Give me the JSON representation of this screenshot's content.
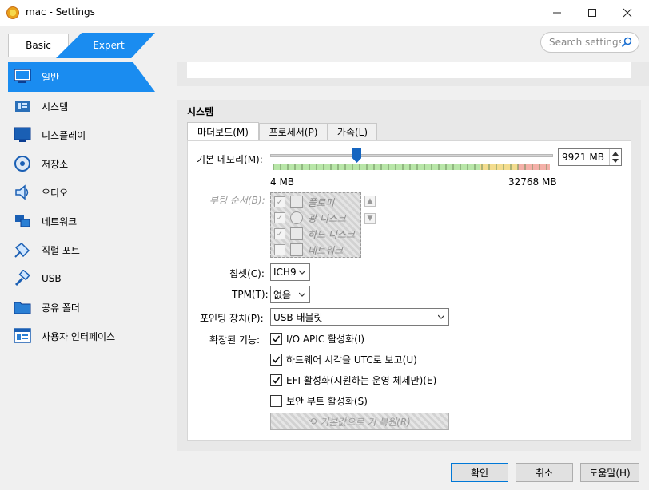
{
  "window": {
    "title": "mac - Settings",
    "minimize": "—",
    "maximize": "☐",
    "close": "✕"
  },
  "mode_tabs": {
    "basic": "Basic",
    "expert": "Expert"
  },
  "search": {
    "placeholder": "Search settings"
  },
  "sidebar": {
    "items": [
      {
        "label": "일반",
        "icon": "general-icon"
      },
      {
        "label": "시스템",
        "icon": "system-icon"
      },
      {
        "label": "디스플레이",
        "icon": "display-icon"
      },
      {
        "label": "저장소",
        "icon": "storage-icon"
      },
      {
        "label": "오디오",
        "icon": "audio-icon"
      },
      {
        "label": "네트워크",
        "icon": "network-icon"
      },
      {
        "label": "직렬 포트",
        "icon": "serial-port-icon"
      },
      {
        "label": "USB",
        "icon": "usb-icon"
      },
      {
        "label": "공유 폴더",
        "icon": "shared-folder-icon"
      },
      {
        "label": "사용자 인터페이스",
        "icon": "user-interface-icon"
      }
    ]
  },
  "system": {
    "title": "시스템",
    "tabs": [
      "마더보드(M)",
      "프로세서(P)",
      "가속(L)"
    ],
    "memory": {
      "label": "기본 메모리(M):",
      "value": "9921 MB",
      "min_label": "4 MB",
      "max_label": "32768 MB",
      "fraction": 0.303
    },
    "boot": {
      "label": "부팅 순서(B):",
      "items": [
        {
          "label": "플로피",
          "checked": true
        },
        {
          "label": "광 디스크",
          "checked": true
        },
        {
          "label": "하드 디스크",
          "checked": true
        },
        {
          "label": "네트워크",
          "checked": false
        }
      ]
    },
    "chipset": {
      "label": "칩셋(C):",
      "value": "ICH9"
    },
    "tpm": {
      "label": "TPM(T):",
      "value": "없음"
    },
    "pointing": {
      "label": "포인팅 장치(P):",
      "value": "USB 태블릿"
    },
    "extended": {
      "label": "확장된 기능:",
      "options": [
        {
          "label": "I/O APIC 활성화(I)",
          "checked": true
        },
        {
          "label": "하드웨어 시각을 UTC로 보고(U)",
          "checked": true
        },
        {
          "label": "EFI 활성화(지원하는 운영 체제만)(E)",
          "checked": true
        },
        {
          "label": "보안 부트 활성화(S)",
          "checked": false
        }
      ]
    },
    "reset_keys": "기본값으로 키 복원(R)"
  },
  "footer": {
    "ok": "확인",
    "cancel": "취소",
    "help": "도움말(H)"
  },
  "colors": {
    "accent": "#1a8cf0"
  }
}
